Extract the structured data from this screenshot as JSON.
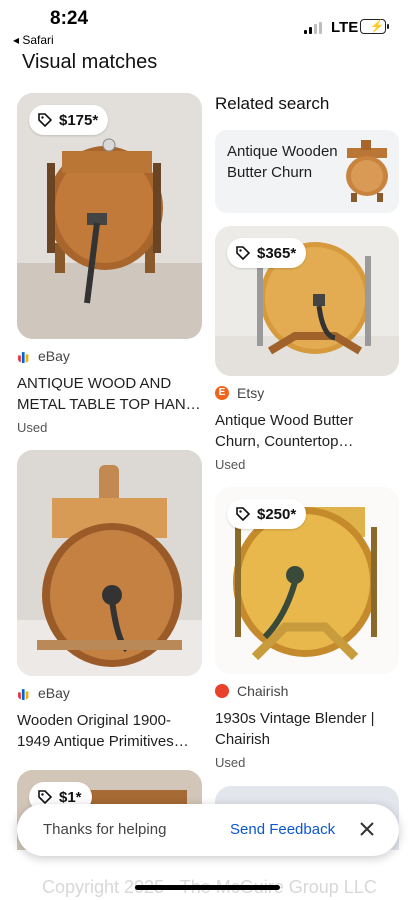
{
  "status_bar": {
    "time": "8:24",
    "back_label": "◂ Safari",
    "network": "LTE"
  },
  "page": {
    "section_title": "Visual matches"
  },
  "related": {
    "heading": "Related search",
    "item_label": "Antique Wooden Butter Churn"
  },
  "cards": [
    {
      "price": "$175*",
      "source": "eBay",
      "title": "ANTIQUE WOOD AND METAL TABLE TOP HAN…",
      "condition": "Used"
    },
    {
      "price": "$365*",
      "source": "Etsy",
      "title": "Antique Wood Butter Churn, Countertop…",
      "condition": "Used"
    },
    {
      "price": "",
      "source": "eBay",
      "title": "Wooden Original 1900-1949 Antique Primitives…",
      "condition": ""
    },
    {
      "price": "$250*",
      "source": "Chairish",
      "title": "1930s Vintage Blender | Chairish",
      "condition": "Used"
    },
    {
      "price": "$1*",
      "source": "",
      "title": "",
      "condition": ""
    }
  ],
  "toast": {
    "message": "Thanks for helping",
    "action": "Send Feedback"
  },
  "watermark": "Copyright 2025 - The McGuire Group LLC",
  "colors": {
    "link": "#0b57d0",
    "etsy": "#f1641e",
    "chairish": "#e8412c"
  }
}
